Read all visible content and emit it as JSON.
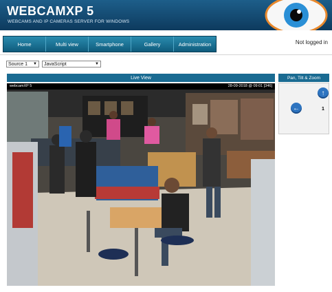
{
  "header": {
    "title": "WEBCAMXP 5",
    "tagline": "WEBCAMS AND IP CAMERAS SERVER FOR WINDOWS"
  },
  "nav": {
    "items": [
      "Home",
      "Multi view",
      "Smartphone",
      "Gallery",
      "Administration"
    ]
  },
  "login_status": "Not logged in",
  "controls": {
    "source_select": "Source 1",
    "player_select": "JavaScript"
  },
  "live_view": {
    "title": "Live View",
    "camera_name": "webcamXP 5",
    "timestamp": "28-09-2018 @ 09:01",
    "frame_counter": "[346]"
  },
  "ptz": {
    "title": "Pan, Tilt & Zoom",
    "step_value": "1"
  },
  "colors": {
    "header_bg": "#0d3a5e",
    "nav_bg": "#1a7499",
    "panel_title_bg": "#1a6b92",
    "ptz_button": "#2e74c0"
  }
}
